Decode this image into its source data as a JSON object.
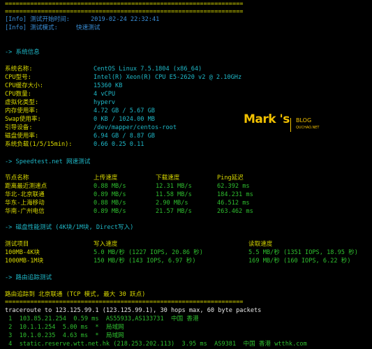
{
  "separator": "==================================================================",
  "info": {
    "start_label": "[Info] 测试开始时间:",
    "start_value": "2019-02-24 22:32:41",
    "mode_label": "[Info] 测试模式:",
    "mode_value": "快速测试"
  },
  "sysinfo": {
    "header": "-> 系统信息",
    "rows": [
      {
        "label": "系统名称:",
        "value": "CentOS Linux 7.5.1804 (x86_64)"
      },
      {
        "label": "CPU型号:",
        "value": "Intel(R) Xeon(R) CPU E5-2620 v2 @ 2.10GHz"
      },
      {
        "label": "CPU缓存大小:",
        "value": "15360 KB"
      },
      {
        "label": "CPU数量:",
        "value": "4 vCPU"
      },
      {
        "label": "虚拟化类型:",
        "value": "hyperv"
      },
      {
        "label": "内存使用率:",
        "value": "4.72 GB / 5.67 GB"
      },
      {
        "label": "Swap使用率:",
        "value": "0 KB / 1024.00 MB"
      },
      {
        "label": "引导设备:",
        "value": "/dev/mapper/centos-root"
      },
      {
        "label": "磁盘使用率:",
        "value": "6.94 GB / 8.87 GB"
      },
      {
        "label": "系统负载(1/5/15min):",
        "value": "0.66 0.25 0.11"
      }
    ]
  },
  "speedtest": {
    "header": "-> Speedtest.net 网速测试",
    "cols": [
      "节点名称",
      "上传速度",
      "下载速度",
      "Ping延迟"
    ],
    "rows": [
      {
        "node": "距离最近测速点",
        "up": "0.88 MB/s",
        "down": "12.31 MB/s",
        "ping": "62.392 ms"
      },
      {
        "node": "华北-北京联通",
        "up": "0.89 MB/s",
        "down": "11.58 MB/s",
        "ping": "184.231 ms"
      },
      {
        "node": "华东-上海移动",
        "up": "0.88 MB/s",
        "down": "2.90 MB/s",
        "ping": "46.512 ms"
      },
      {
        "node": "华南-广州电信",
        "up": "0.89 MB/s",
        "down": "21.57 MB/s",
        "ping": "263.462 ms"
      }
    ]
  },
  "disk": {
    "header": "-> 磁盘性能测试 (4K块/1M块, Direct写入)",
    "cols": [
      "测试项目",
      "写入速度",
      "读取速度"
    ],
    "rows": [
      {
        "item": "100MB-4K块",
        "write": "5.0 MB/秒 (1227 IOPS, 20.86 秒)",
        "read": "5.5 MB/秒 (1351 IOPS, 18.95 秒)"
      },
      {
        "item": "1000MB-1M块",
        "write": "150 MB/秒 (143 IOPS, 6.97 秒)",
        "read": "169 MB/秒 (160 IOPS, 6.22 秒)"
      }
    ]
  },
  "route": {
    "header": "-> 路由追踪测试",
    "title": "路由追踪到 北京联通 (TCP 模式, 最大 30 跃点)",
    "traceroute": "traceroute to 123.125.99.1 (123.125.99.1), 30 hops max, 60 byte packets",
    "hops": [
      " 1  103.85.21.254  0.59 ms  AS55933,AS133731  中国 香港",
      " 2  10.1.1.254  5.00 ms  *  局域网",
      " 3  10.1.0.235  4.63 ms  *  局域网",
      " 4  static.reserve.wtt.net.hk (218.253.202.113)  3.95 ms  AS9381  中国 香港 wtthk.com"
    ]
  },
  "watermark": {
    "mark": "Mark 's",
    "blog": "BLOG",
    "sub": "QUCHAO.NET"
  },
  "colors": {
    "background": "#000000",
    "info": "#3a8fd8",
    "header": "#1fb8c8",
    "table": "#2fbf2f",
    "separator": "#d9d900"
  }
}
